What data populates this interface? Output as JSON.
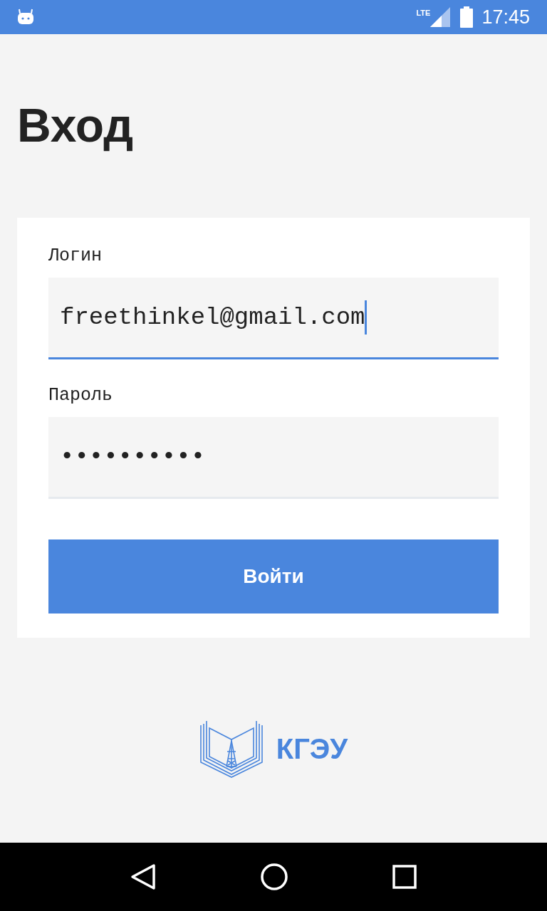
{
  "status_bar": {
    "network": "LTE",
    "time": "17:45"
  },
  "title": "Вход",
  "fields": [
    {
      "label": "Логин",
      "value": "freethinkel@gmail.com",
      "focused": true
    },
    {
      "label": "Пароль",
      "value": "••••••••••",
      "focused": false
    }
  ],
  "submit_button": "Войти",
  "logo": {
    "text": "КГЭУ"
  }
}
